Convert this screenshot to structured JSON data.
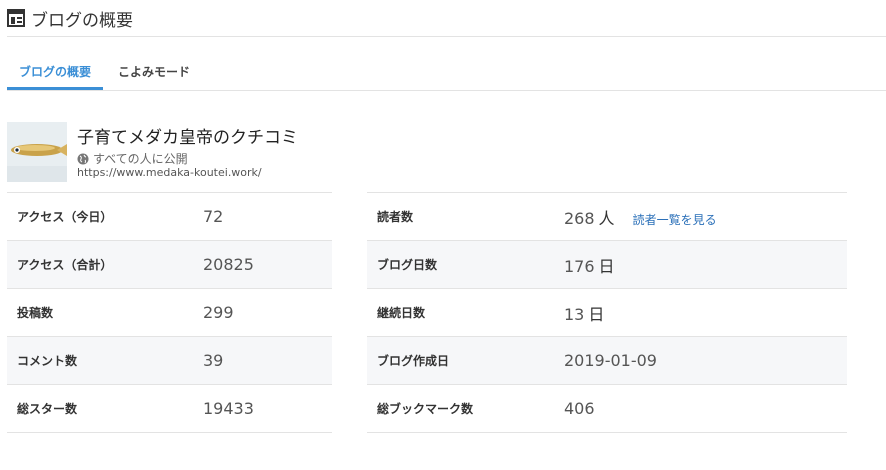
{
  "header": {
    "title": "ブログの概要",
    "icon": "dashboard-layout-icon"
  },
  "tabs": [
    {
      "label": "ブログの概要",
      "active": true
    },
    {
      "label": "こよみモード",
      "active": false
    }
  ],
  "blog": {
    "title": "子育てメダカ皇帝のクチコミ",
    "visibility": "すべての人に公開",
    "url": "https://www.medaka-koutei.work/",
    "thumbnail": "medaka-fish-thumbnail"
  },
  "stats_left": [
    {
      "label": "アクセス（今日）",
      "value": "72"
    },
    {
      "label": "アクセス（合計）",
      "value": "20825"
    },
    {
      "label": "投稿数",
      "value": "299"
    },
    {
      "label": "コメント数",
      "value": "39"
    },
    {
      "label": "総スター数",
      "value": "19433"
    }
  ],
  "stats_right": [
    {
      "label": "読者数",
      "value": "268",
      "unit": "人",
      "link": "読者一覧を見る"
    },
    {
      "label": "ブログ日数",
      "value": "176",
      "unit": "日"
    },
    {
      "label": "継続日数",
      "value": "13",
      "unit": "日"
    },
    {
      "label": "ブログ作成日",
      "value": "2019-01-09"
    },
    {
      "label": "総ブックマーク数",
      "value": "406"
    }
  ],
  "colors": {
    "accent": "#3b8fd6",
    "link": "#2a6fb8",
    "border": "#e3e3e3",
    "row_alt": "#f6f7f9"
  }
}
